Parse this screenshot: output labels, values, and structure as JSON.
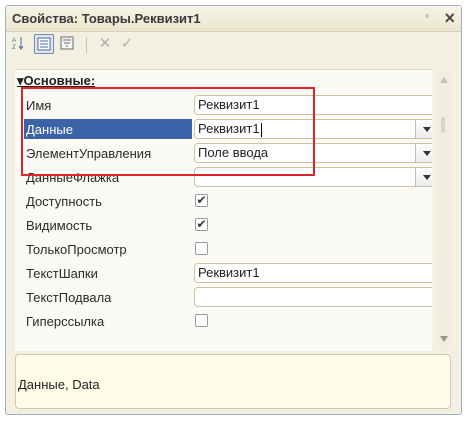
{
  "window": {
    "title": "Свойства: Товары.Реквизит1"
  },
  "toolbar": {
    "buttons": [
      {
        "name": "sort-alpha-icon"
      },
      {
        "name": "categories-icon",
        "pressed": true
      },
      {
        "name": "filter-icon"
      }
    ],
    "close_label": "✕",
    "check_label": "✓"
  },
  "group": {
    "label": "Основные:"
  },
  "properties": [
    {
      "label": "Имя",
      "type": "text",
      "value": "Реквизит1"
    },
    {
      "label": "Данные",
      "type": "dropdown",
      "value": "Реквизит1",
      "selected": true
    },
    {
      "label": "ЭлементУправления",
      "type": "dropdown",
      "value": "Поле ввода"
    },
    {
      "label": "ДанныеФлажка",
      "type": "dropdown",
      "value": ""
    },
    {
      "label": "Доступность",
      "type": "checkbox",
      "checked": true
    },
    {
      "label": "Видимость",
      "type": "checkbox",
      "checked": true
    },
    {
      "label": "ТолькоПросмотр",
      "type": "checkbox",
      "checked": false
    },
    {
      "label": "ТекстШапки",
      "type": "text",
      "value": "Реквизит1"
    },
    {
      "label": "ТекстПодвала",
      "type": "text",
      "value": ""
    },
    {
      "label": "Гиперссылка",
      "type": "checkbox",
      "checked": false
    }
  ],
  "description": "Данные, Data",
  "colors": {
    "highlight": "#3c63a8",
    "annotation": "#e0242c"
  }
}
